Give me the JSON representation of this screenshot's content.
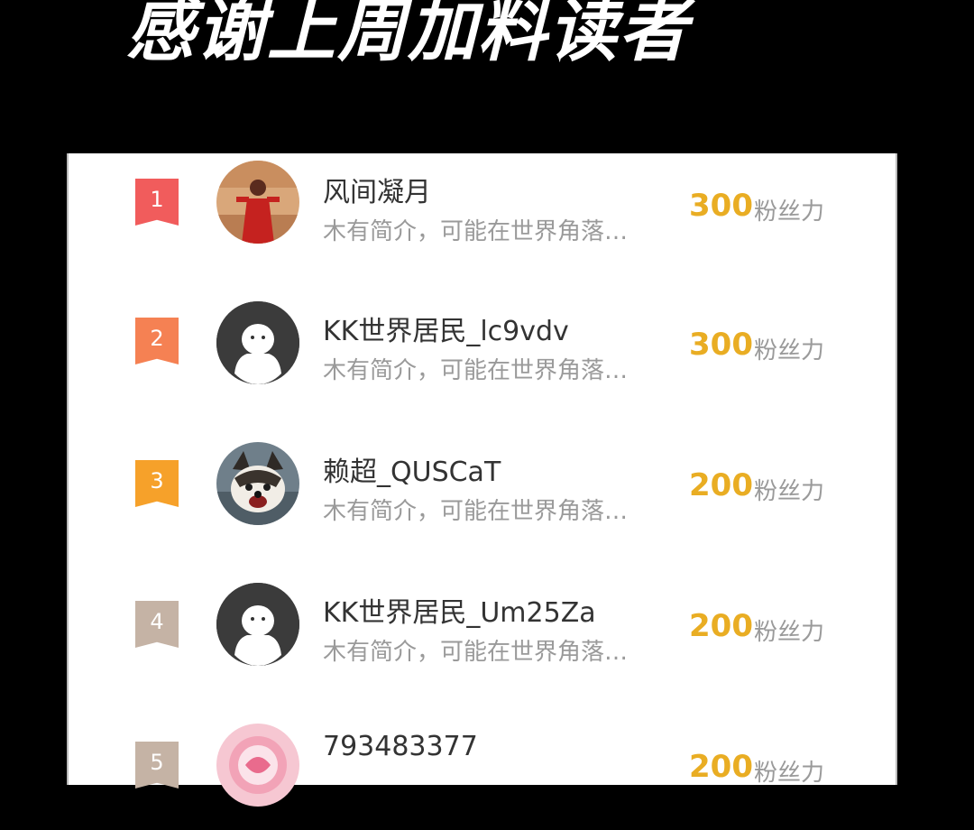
{
  "banner": {
    "title": "感谢上周加料读者"
  },
  "colors": {
    "rank1": "#f15c5c",
    "rank2": "#f58153",
    "rank3": "#f6a12a",
    "rank_other": "#c5b3a5",
    "score": "#e9ad23"
  },
  "list": [
    {
      "rank": "1",
      "name": "风间凝月",
      "bio": "木有简介，可能在世界角落…",
      "score": "300",
      "unit": "粉丝力",
      "avatar": "photo-red-dress"
    },
    {
      "rank": "2",
      "name": "KK世界居民_lc9vdv",
      "bio": "木有简介，可能在世界角落…",
      "score": "300",
      "unit": "粉丝力",
      "avatar": "default-ghost"
    },
    {
      "rank": "3",
      "name": "赖超_QUSCaT",
      "bio": "木有简介，可能在世界角落…",
      "score": "200",
      "unit": "粉丝力",
      "avatar": "photo-husky"
    },
    {
      "rank": "4",
      "name": "KK世界居民_Um25Za",
      "bio": "木有简介，可能在世界角落…",
      "score": "200",
      "unit": "粉丝力",
      "avatar": "default-ghost"
    },
    {
      "rank": "5",
      "name": "793483377",
      "bio": "",
      "score": "200",
      "unit": "粉丝力",
      "avatar": "pink-pattern"
    }
  ]
}
